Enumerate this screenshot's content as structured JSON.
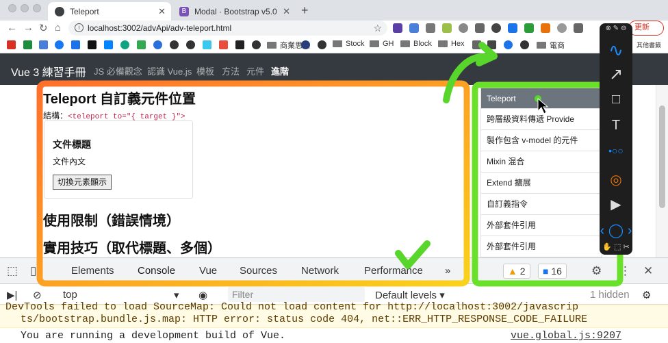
{
  "browser": {
    "tabs": [
      {
        "title": "Teleport",
        "close": "✕",
        "favicon_color": "#3c4043"
      },
      {
        "title": "Modal · Bootstrap v5.0",
        "close": "✕",
        "favicon_color": "#7952b3",
        "favicon_letter": "B"
      }
    ],
    "new_tab": "+",
    "url": "localhost:3002/advApi/adv-teleport.html",
    "update_label": "更新",
    "bookmarks": [
      "商業思維",
      "Stock",
      "GH",
      "Block",
      "Hex",
      "電商"
    ],
    "bookmarks_overflow": "其他書籤"
  },
  "page": {
    "brand": "Vue 3 練習手冊",
    "nav": [
      "JS 必備觀念",
      "認識 Vue.js",
      "模板",
      "方法",
      "元件",
      "進階"
    ],
    "heading": "Teleport 自訂義元件位置",
    "structure_label": "結構：",
    "structure_code": "<teleport to=\"{ target }\">",
    "card_title": "文件標題",
    "card_body": "文件內文",
    "card_button": "切換元素顯示",
    "heading2": "使用限制（錯誤情境）",
    "heading3": "實用技巧（取代標題、多個）",
    "sidebar": [
      "Teleport",
      "跨層級資料傳遞 Provide",
      "製作包含 v-model 的元件",
      "Mixin 混合",
      "Extend 擴展",
      "自訂義指令",
      "外部套件引用",
      "外部套件引用"
    ]
  },
  "devtools": {
    "tabs": [
      "Elements",
      "Console",
      "Vue",
      "Sources",
      "Network",
      "Performance"
    ],
    "more": "»",
    "warnings": "2",
    "messages": "16",
    "context": "top",
    "filter_placeholder": "Filter",
    "levels": "Default levels ▾",
    "hidden": "1 hidden",
    "warn_line1": "DevTools failed to load SourceMap: Could not load content for http://localhost:3002/javascrip",
    "warn_line2": "ts/bootstrap.bundle.js.map: HTTP error: status code 404, net::ERR_HTTP_RESPONSE_CODE_FAILURE",
    "log_line": "You are running a development build of Vue.",
    "log_source": "vue.global.js:9207"
  },
  "colors": {
    "orange_box": "#ff8a1f",
    "yellow_box": "#f7d21c",
    "green_box": "#6be02a",
    "green_arrow": "#58d62b"
  }
}
